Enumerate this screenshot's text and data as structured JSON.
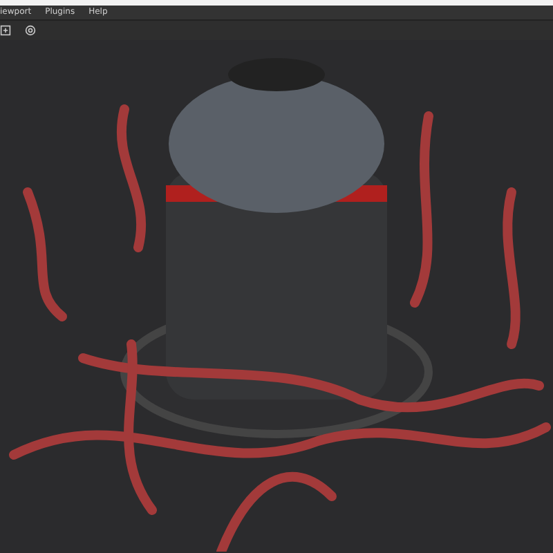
{
  "menu_bar": {
    "items": [
      {
        "label": "iewport"
      },
      {
        "label": "Plugins"
      },
      {
        "label": "Help"
      }
    ]
  },
  "toolbar": {
    "buttons": [
      {
        "kind": "add"
      },
      {
        "kind": "target"
      }
    ]
  }
}
